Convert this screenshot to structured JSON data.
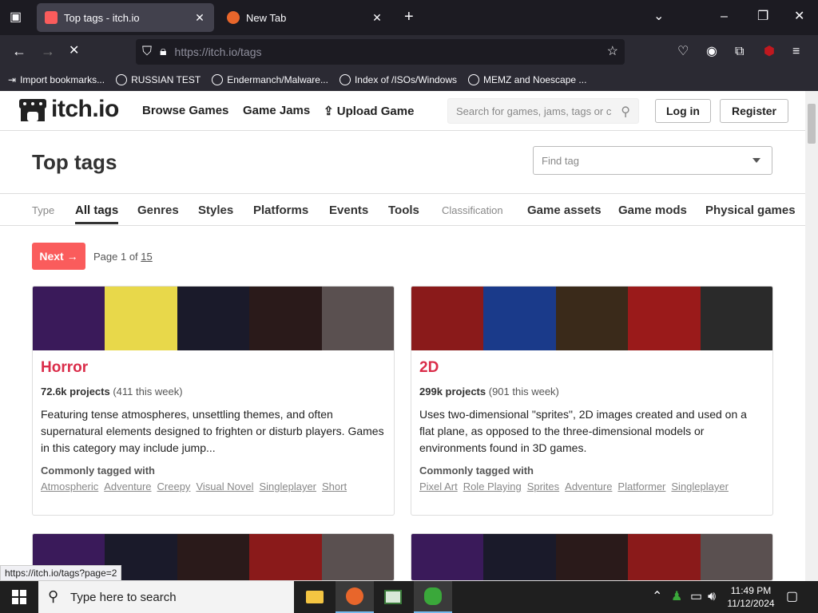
{
  "browser": {
    "tabs": [
      {
        "title": "Top tags - itch.io",
        "active": true
      },
      {
        "title": "New Tab",
        "active": false
      }
    ],
    "url_protocol": "https://",
    "url_rest": "itch.io/tags",
    "bookmarks": [
      "Import bookmarks...",
      "RUSSIAN TEST",
      "Endermanch/Malware...",
      "Index of /ISOs/Windows",
      "MEMZ and Noescape ..."
    ]
  },
  "site": {
    "logo_text": "itch.io",
    "nav": [
      "Browse Games",
      "Game Jams",
      "Upload Game"
    ],
    "search_placeholder": "Search for games, jams, tags or c",
    "login": "Log in",
    "register": "Register"
  },
  "page": {
    "title": "Top tags",
    "find_tag_placeholder": "Find tag",
    "tag_nav": {
      "type_label": "Type",
      "classification_label": "Classification",
      "items": [
        "All tags",
        "Genres",
        "Styles",
        "Platforms",
        "Events",
        "Tools",
        "Game assets",
        "Game mods",
        "Physical games"
      ]
    },
    "next_label": "Next →",
    "page_prefix": "Page 1 of",
    "page_total": "15"
  },
  "cards": [
    {
      "name": "Horror",
      "projects": "72.6k projects",
      "week": "(411 this week)",
      "description": "Featuring tense atmospheres, unsettling themes, and often supernatural elements designed to frighten or disturb players. Games in this category may include jump...",
      "tagged_label": "Commonly tagged with",
      "tags": [
        "Atmospheric",
        "Adventure",
        "Creepy",
        "Visual Novel",
        "Singleplayer",
        "Short"
      ],
      "colors": [
        "#3a1a5a",
        "#e8d84a",
        "#1a1a2a",
        "#2a1a1a",
        "#5a5050"
      ]
    },
    {
      "name": "2D",
      "projects": "299k projects",
      "week": "(901 this week)",
      "description": "Uses two-dimensional \"sprites\", 2D images created and used on a flat plane, as opposed to the three-dimensional models or environments found in 3D games.",
      "tagged_label": "Commonly tagged with",
      "tags": [
        "Pixel Art",
        "Role Playing",
        "Sprites",
        "Adventure",
        "Platformer",
        "Singleplayer"
      ],
      "colors": [
        "#8a1a1a",
        "#1a3a8a",
        "#3a2a1a",
        "#9a1a1a",
        "#2a2a2a"
      ]
    }
  ],
  "status_url": "https://itch.io/tags?page=2",
  "taskbar": {
    "search_placeholder": "Type here to search",
    "time": "11:49 PM",
    "date": "11/12/2024"
  }
}
